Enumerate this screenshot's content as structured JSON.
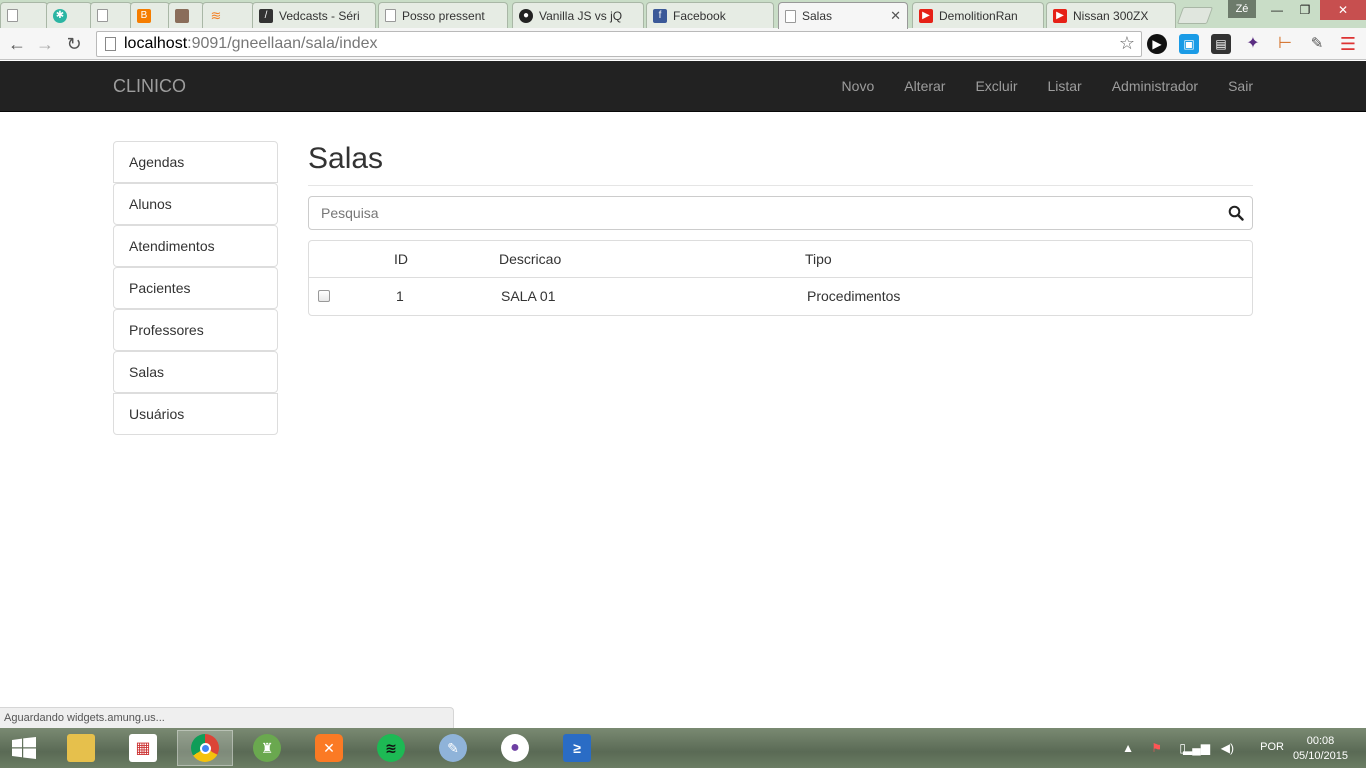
{
  "browser": {
    "tabs": [
      {
        "label": "",
        "fav": "doc"
      },
      {
        "label": "",
        "fav": "gear"
      },
      {
        "label": "",
        "fav": "doc"
      },
      {
        "label": "",
        "fav": "blogger"
      },
      {
        "label": "",
        "fav": "avatar"
      },
      {
        "label": "",
        "fav": "stack"
      },
      {
        "label": "Vedcasts - Séri",
        "fav": "vedcasts"
      },
      {
        "label": "Posso pressent",
        "fav": "doc"
      },
      {
        "label": "Vanilla JS vs jQ",
        "fav": "github"
      },
      {
        "label": "Facebook",
        "fav": "facebook"
      },
      {
        "label": "Salas",
        "fav": "doc"
      },
      {
        "label": "DemolitionRan",
        "fav": "youtube"
      },
      {
        "label": "Nissan 300ZX",
        "fav": "youtube"
      }
    ],
    "user_badge": "Zé",
    "url_host": "localhost",
    "url_rest": ":9091/gneellaan/sala/index"
  },
  "app": {
    "brand": "CLINICO",
    "nav": [
      "Novo",
      "Alterar",
      "Excluir",
      "Listar",
      "Administrador",
      "Sair"
    ],
    "sidebar": [
      "Agendas",
      "Alunos",
      "Atendimentos",
      "Pacientes",
      "Professores",
      "Salas",
      "Usuários"
    ],
    "page_title": "Salas",
    "search_placeholder": "Pesquisa",
    "table": {
      "columns": [
        "ID",
        "Descricao",
        "Tipo"
      ],
      "rows": [
        {
          "id": "1",
          "descricao": "SALA 01",
          "tipo": "Procedimentos"
        }
      ]
    }
  },
  "status_text": "Aguardando widgets.amung.us...",
  "taskbar": {
    "lang": "POR",
    "time": "00:08",
    "date": "05/10/2015"
  },
  "colors": {
    "navbar_bg": "#222222",
    "navbar_text": "#9d9d9d",
    "tabstrip_bg": "#c9ddc7"
  }
}
